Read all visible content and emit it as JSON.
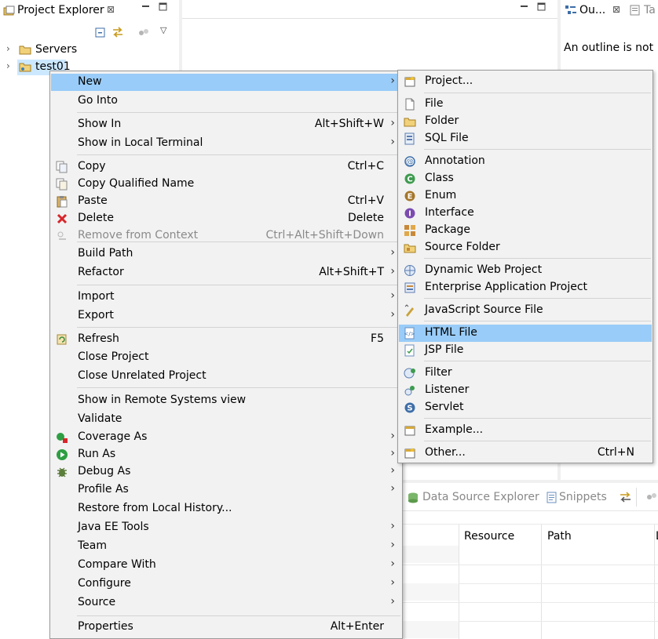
{
  "project_explorer": {
    "tab_label": "Project Explorer",
    "tree": [
      {
        "label": "Servers",
        "icon": "folder-icon"
      },
      {
        "label": "test01",
        "icon": "project-icon"
      }
    ]
  },
  "outline": {
    "tab_label": "Ou...",
    "tab2_label": "Ta",
    "message": "An outline is not"
  },
  "bottom_panel": {
    "tabs": [
      {
        "label": "Data Source Explorer",
        "icon": "database-icon"
      },
      {
        "label": "Snippets",
        "icon": "snippets-icon"
      }
    ],
    "columns": [
      "Resource",
      "Path",
      "L"
    ]
  },
  "context_menu": {
    "items": [
      {
        "label": "New",
        "accel": "",
        "submenu": true,
        "icon": ""
      },
      {
        "label": "Go Into",
        "accel": "",
        "submenu": false,
        "icon": ""
      },
      {
        "label": "Show In",
        "accel": "Alt+Shift+W",
        "submenu": true,
        "icon": ""
      },
      {
        "label": "Show in Local Terminal",
        "accel": "",
        "submenu": true,
        "icon": ""
      },
      {
        "label": "Copy",
        "accel": "Ctrl+C",
        "submenu": false,
        "icon": "copy-icon"
      },
      {
        "label": "Copy Qualified Name",
        "accel": "",
        "submenu": false,
        "icon": "copy-qualified-icon"
      },
      {
        "label": "Paste",
        "accel": "Ctrl+V",
        "submenu": false,
        "icon": "paste-icon"
      },
      {
        "label": "Delete",
        "accel": "Delete",
        "submenu": false,
        "icon": "delete-icon"
      },
      {
        "label": "Remove from Context",
        "accel": "Ctrl+Alt+Shift+Down",
        "submenu": false,
        "icon": "remove-context-icon"
      },
      {
        "label": "Build Path",
        "accel": "",
        "submenu": true,
        "icon": ""
      },
      {
        "label": "Refactor",
        "accel": "Alt+Shift+T",
        "submenu": true,
        "icon": ""
      },
      {
        "label": "Import",
        "accel": "",
        "submenu": true,
        "icon": ""
      },
      {
        "label": "Export",
        "accel": "",
        "submenu": true,
        "icon": ""
      },
      {
        "label": "Refresh",
        "accel": "F5",
        "submenu": false,
        "icon": "refresh-icon"
      },
      {
        "label": "Close Project",
        "accel": "",
        "submenu": false,
        "icon": ""
      },
      {
        "label": "Close Unrelated Project",
        "accel": "",
        "submenu": false,
        "icon": ""
      },
      {
        "label": "Show in Remote Systems view",
        "accel": "",
        "submenu": false,
        "icon": ""
      },
      {
        "label": "Validate",
        "accel": "",
        "submenu": false,
        "icon": ""
      },
      {
        "label": "Coverage As",
        "accel": "",
        "submenu": true,
        "icon": "coverage-icon"
      },
      {
        "label": "Run As",
        "accel": "",
        "submenu": true,
        "icon": "run-icon"
      },
      {
        "label": "Debug As",
        "accel": "",
        "submenu": true,
        "icon": "debug-icon"
      },
      {
        "label": "Profile As",
        "accel": "",
        "submenu": true,
        "icon": ""
      },
      {
        "label": "Restore from Local History...",
        "accel": "",
        "submenu": false,
        "icon": ""
      },
      {
        "label": "Java EE Tools",
        "accel": "",
        "submenu": true,
        "icon": ""
      },
      {
        "label": "Team",
        "accel": "",
        "submenu": true,
        "icon": ""
      },
      {
        "label": "Compare With",
        "accel": "",
        "submenu": true,
        "icon": ""
      },
      {
        "label": "Configure",
        "accel": "",
        "submenu": true,
        "icon": ""
      },
      {
        "label": "Source",
        "accel": "",
        "submenu": true,
        "icon": ""
      },
      {
        "label": "Properties",
        "accel": "Alt+Enter",
        "submenu": false,
        "icon": ""
      }
    ]
  },
  "new_submenu": {
    "items": [
      {
        "label": "Project...",
        "accel": "",
        "icon": "new-project-icon"
      },
      {
        "label": "File",
        "accel": "",
        "icon": "file-icon"
      },
      {
        "label": "Folder",
        "accel": "",
        "icon": "folder-icon"
      },
      {
        "label": "SQL File",
        "accel": "",
        "icon": "sql-file-icon"
      },
      {
        "label": "Annotation",
        "accel": "",
        "icon": "annotation-icon"
      },
      {
        "label": "Class",
        "accel": "",
        "icon": "class-icon"
      },
      {
        "label": "Enum",
        "accel": "",
        "icon": "enum-icon"
      },
      {
        "label": "Interface",
        "accel": "",
        "icon": "interface-icon"
      },
      {
        "label": "Package",
        "accel": "",
        "icon": "package-icon"
      },
      {
        "label": "Source Folder",
        "accel": "",
        "icon": "source-folder-icon"
      },
      {
        "label": "Dynamic Web Project",
        "accel": "",
        "icon": "web-project-icon"
      },
      {
        "label": "Enterprise Application Project",
        "accel": "",
        "icon": "ear-project-icon"
      },
      {
        "label": "JavaScript Source File",
        "accel": "",
        "icon": "javascript-file-icon"
      },
      {
        "label": "HTML File",
        "accel": "",
        "icon": "html-file-icon"
      },
      {
        "label": "JSP File",
        "accel": "",
        "icon": "jsp-file-icon"
      },
      {
        "label": "Filter",
        "accel": "",
        "icon": "filter-icon"
      },
      {
        "label": "Listener",
        "accel": "",
        "icon": "listener-icon"
      },
      {
        "label": "Servlet",
        "accel": "",
        "icon": "servlet-icon"
      },
      {
        "label": "Example...",
        "accel": "",
        "icon": "example-icon"
      },
      {
        "label": "Other...",
        "accel": "Ctrl+N",
        "icon": "other-icon"
      }
    ]
  }
}
